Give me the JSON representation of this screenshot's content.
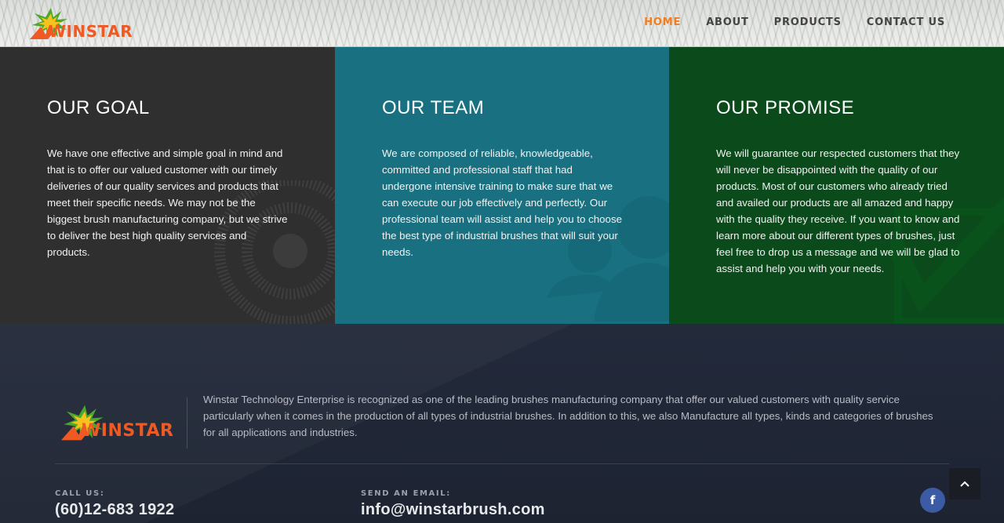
{
  "brand": {
    "name": "WINSTAR"
  },
  "nav": [
    {
      "label": "HOME",
      "active": true
    },
    {
      "label": "ABOUT",
      "active": false
    },
    {
      "label": "PRODUCTS",
      "active": false
    },
    {
      "label": "CONTACT US",
      "active": false
    }
  ],
  "sections": {
    "goal": {
      "title": "OUR GOAL",
      "text": "We have one effective and simple goal in mind and that is to offer our valued customer with our timely deliveries of our quality services and products that meet their specific needs. We may not be the biggest brush manufacturing company, but we strive to deliver the best high quality services and products."
    },
    "team": {
      "title": "OUR TEAM",
      "text": "We are composed of reliable, knowledgeable, committed and professional staff that had undergone intensive training to make sure that we can execute our job effectively and perfectly. Our professional team will assist and help you to choose the best type of industrial brushes that will suit your needs."
    },
    "promise": {
      "title": "OUR PROMISE",
      "text": "We will guarantee our respected customers that they will never be disappointed with the quality of our products. Most of our customers who already tried and availed our products are all amazed and happy with the quality they receive. If you want to know and learn more about our different types of brushes, just feel free to drop us a message and we will be glad to assist and help you with your needs."
    }
  },
  "footer": {
    "about": "Winstar Technology Enterprise is recognized as one of the leading brushes manufacturing company that offer our valued customers with quality service particularly when it comes in the production of all types of industrial brushes. In addition to this, we also Manufacture all types, kinds and categories of brushes for all applications and industries.",
    "call_label": "CALL US:",
    "call_value": "(60)12-683 1922",
    "email_label": "SEND AN EMAIL:",
    "email_value": "info@winstarbrush.com",
    "social_icon": "facebook-icon",
    "scroll_top_icon": "chevron-up-icon"
  },
  "colors": {
    "accent": "#ef7d22",
    "goal_bg": "#2f2f30",
    "team_bg": "#197080",
    "promise_bg": "#0b4a1b",
    "footer_bg": "#1f2533",
    "facebook": "#3b5ba5"
  }
}
